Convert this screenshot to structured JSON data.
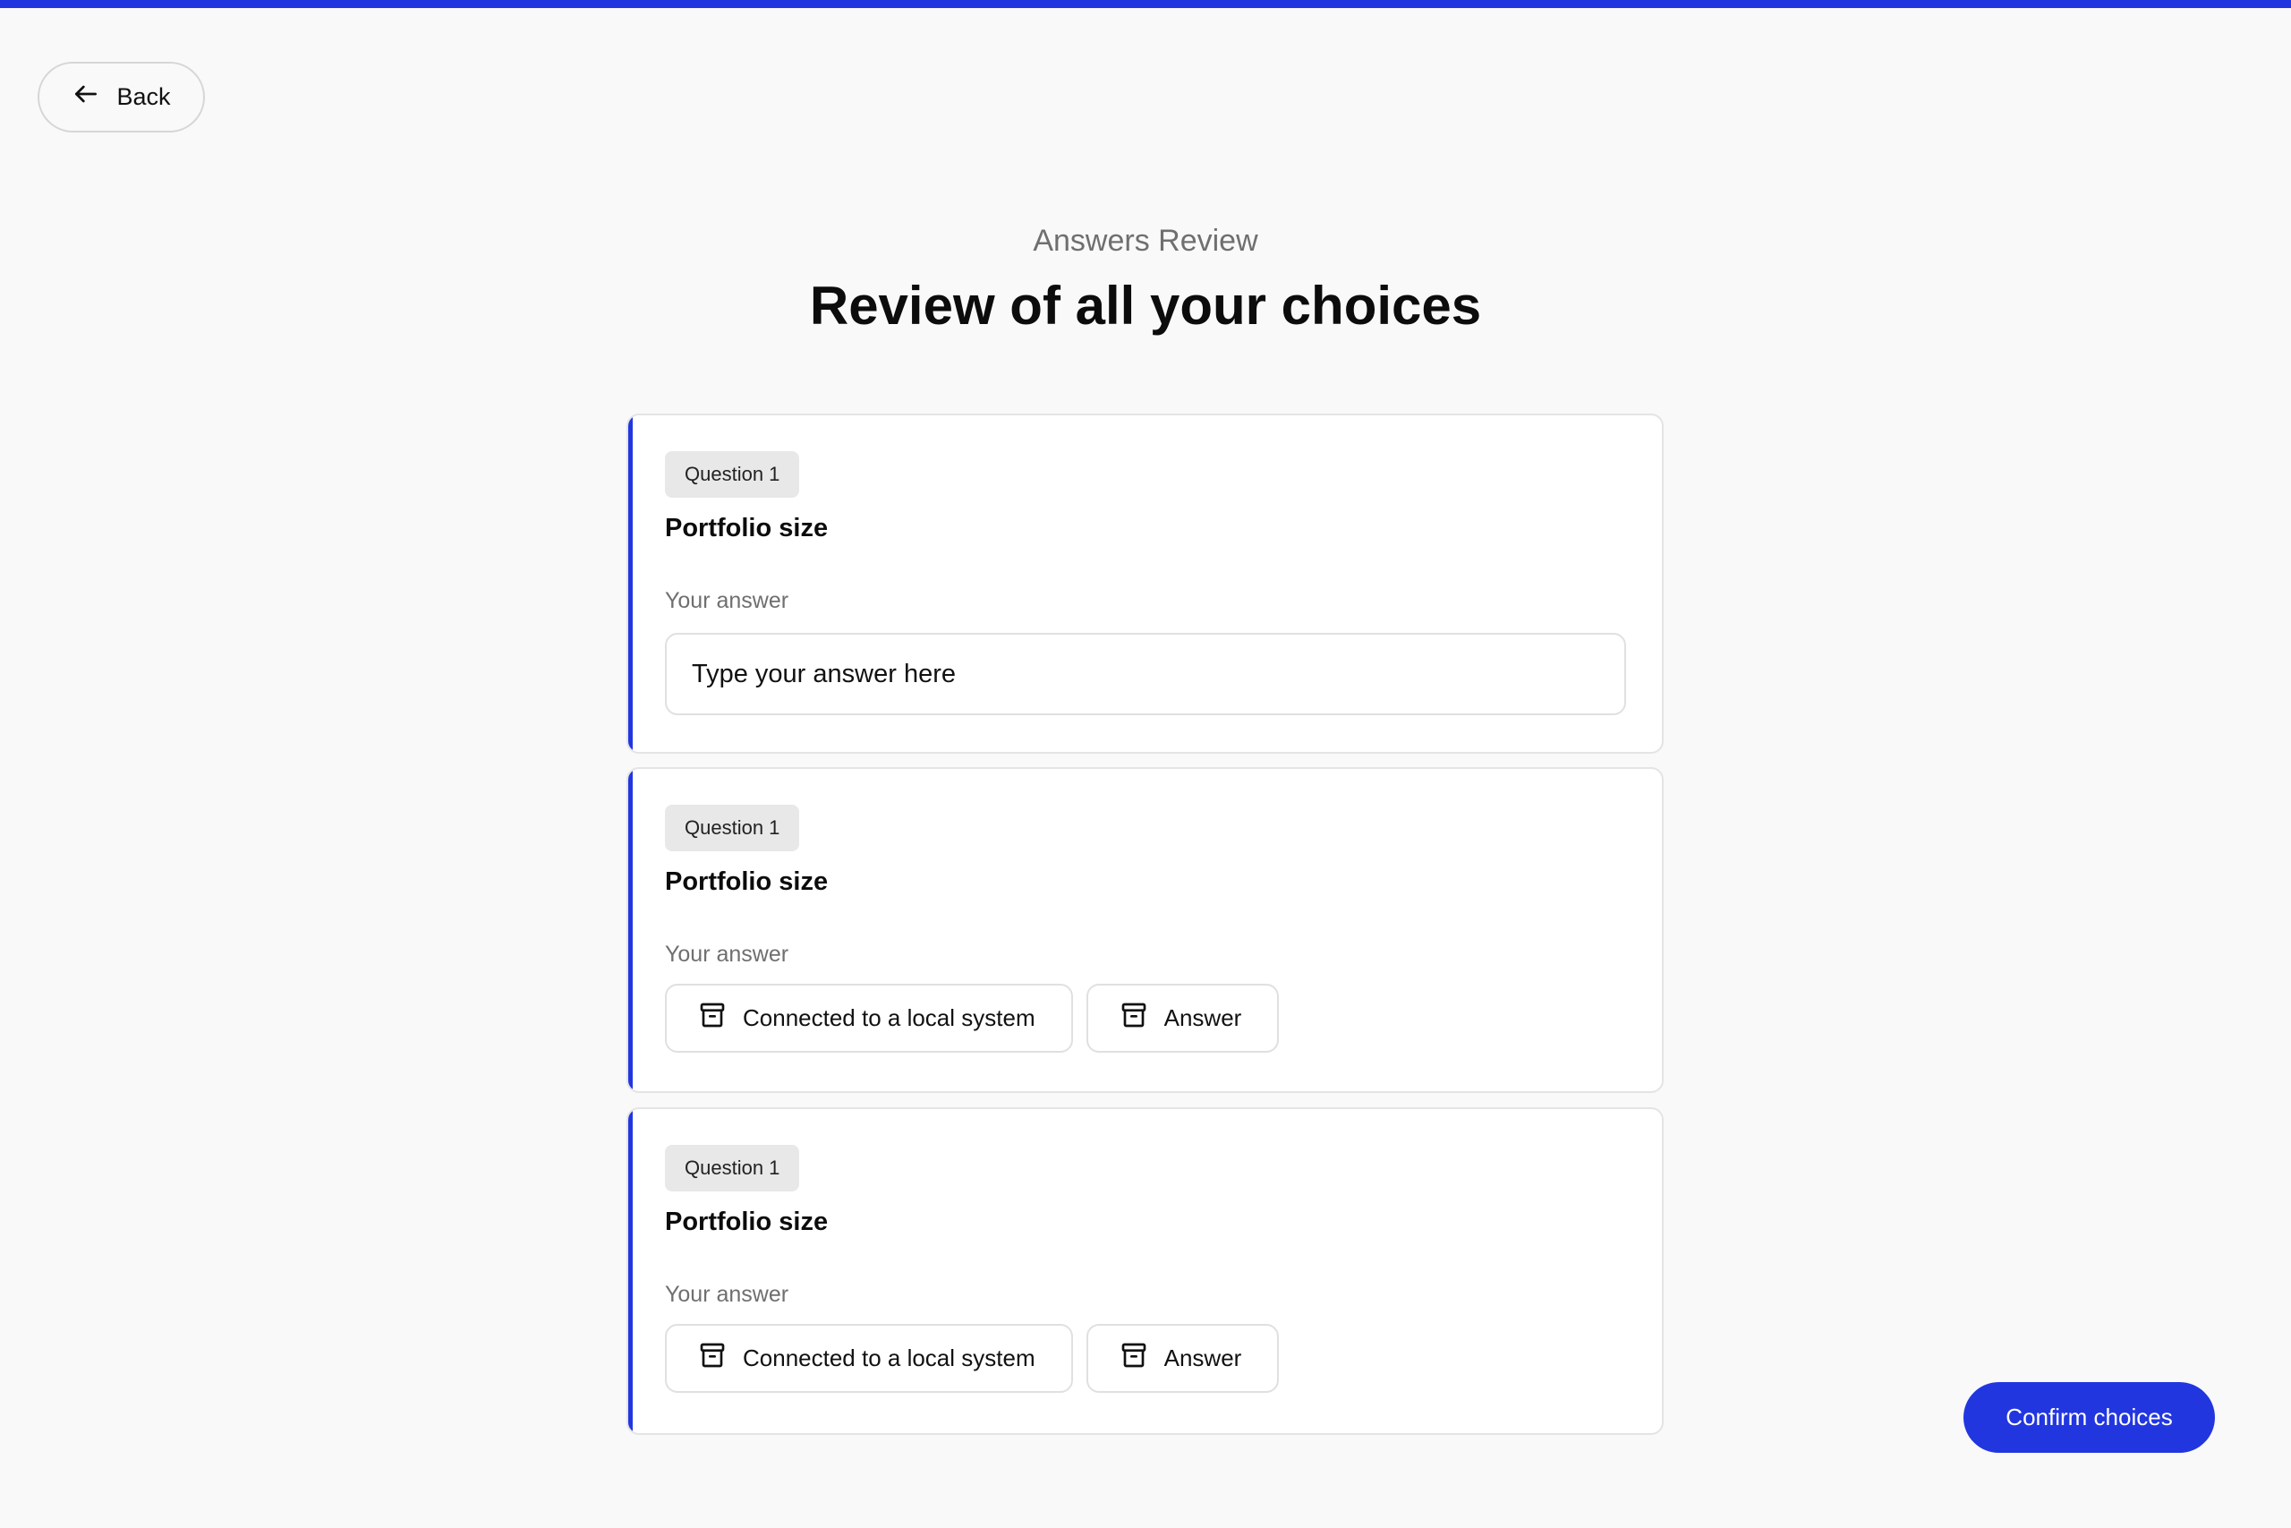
{
  "header": {
    "back_label": "Back",
    "eyebrow": "Answers Review",
    "title": "Review of all your choices"
  },
  "questions": [
    {
      "badge": "Question 1",
      "title": "Portfolio size",
      "answer_label": "Your answer",
      "input_placeholder": "Type your answer here"
    },
    {
      "badge": "Question 1",
      "title": "Portfolio size",
      "answer_label": "Your answer",
      "chips": [
        {
          "label": "Connected to a local system",
          "icon": "archive-icon"
        },
        {
          "label": "Answer",
          "icon": "archive-icon"
        }
      ]
    },
    {
      "badge": "Question 1",
      "title": "Portfolio size",
      "answer_label": "Your answer",
      "chips": [
        {
          "label": "Connected to a local system",
          "icon": "archive-icon"
        },
        {
          "label": "Answer",
          "icon": "archive-icon"
        }
      ]
    }
  ],
  "footer": {
    "confirm_label": "Confirm choices"
  },
  "colors": {
    "accent": "#2236e0",
    "background": "#f9f9f9",
    "muted_text": "#6f6f6f"
  }
}
